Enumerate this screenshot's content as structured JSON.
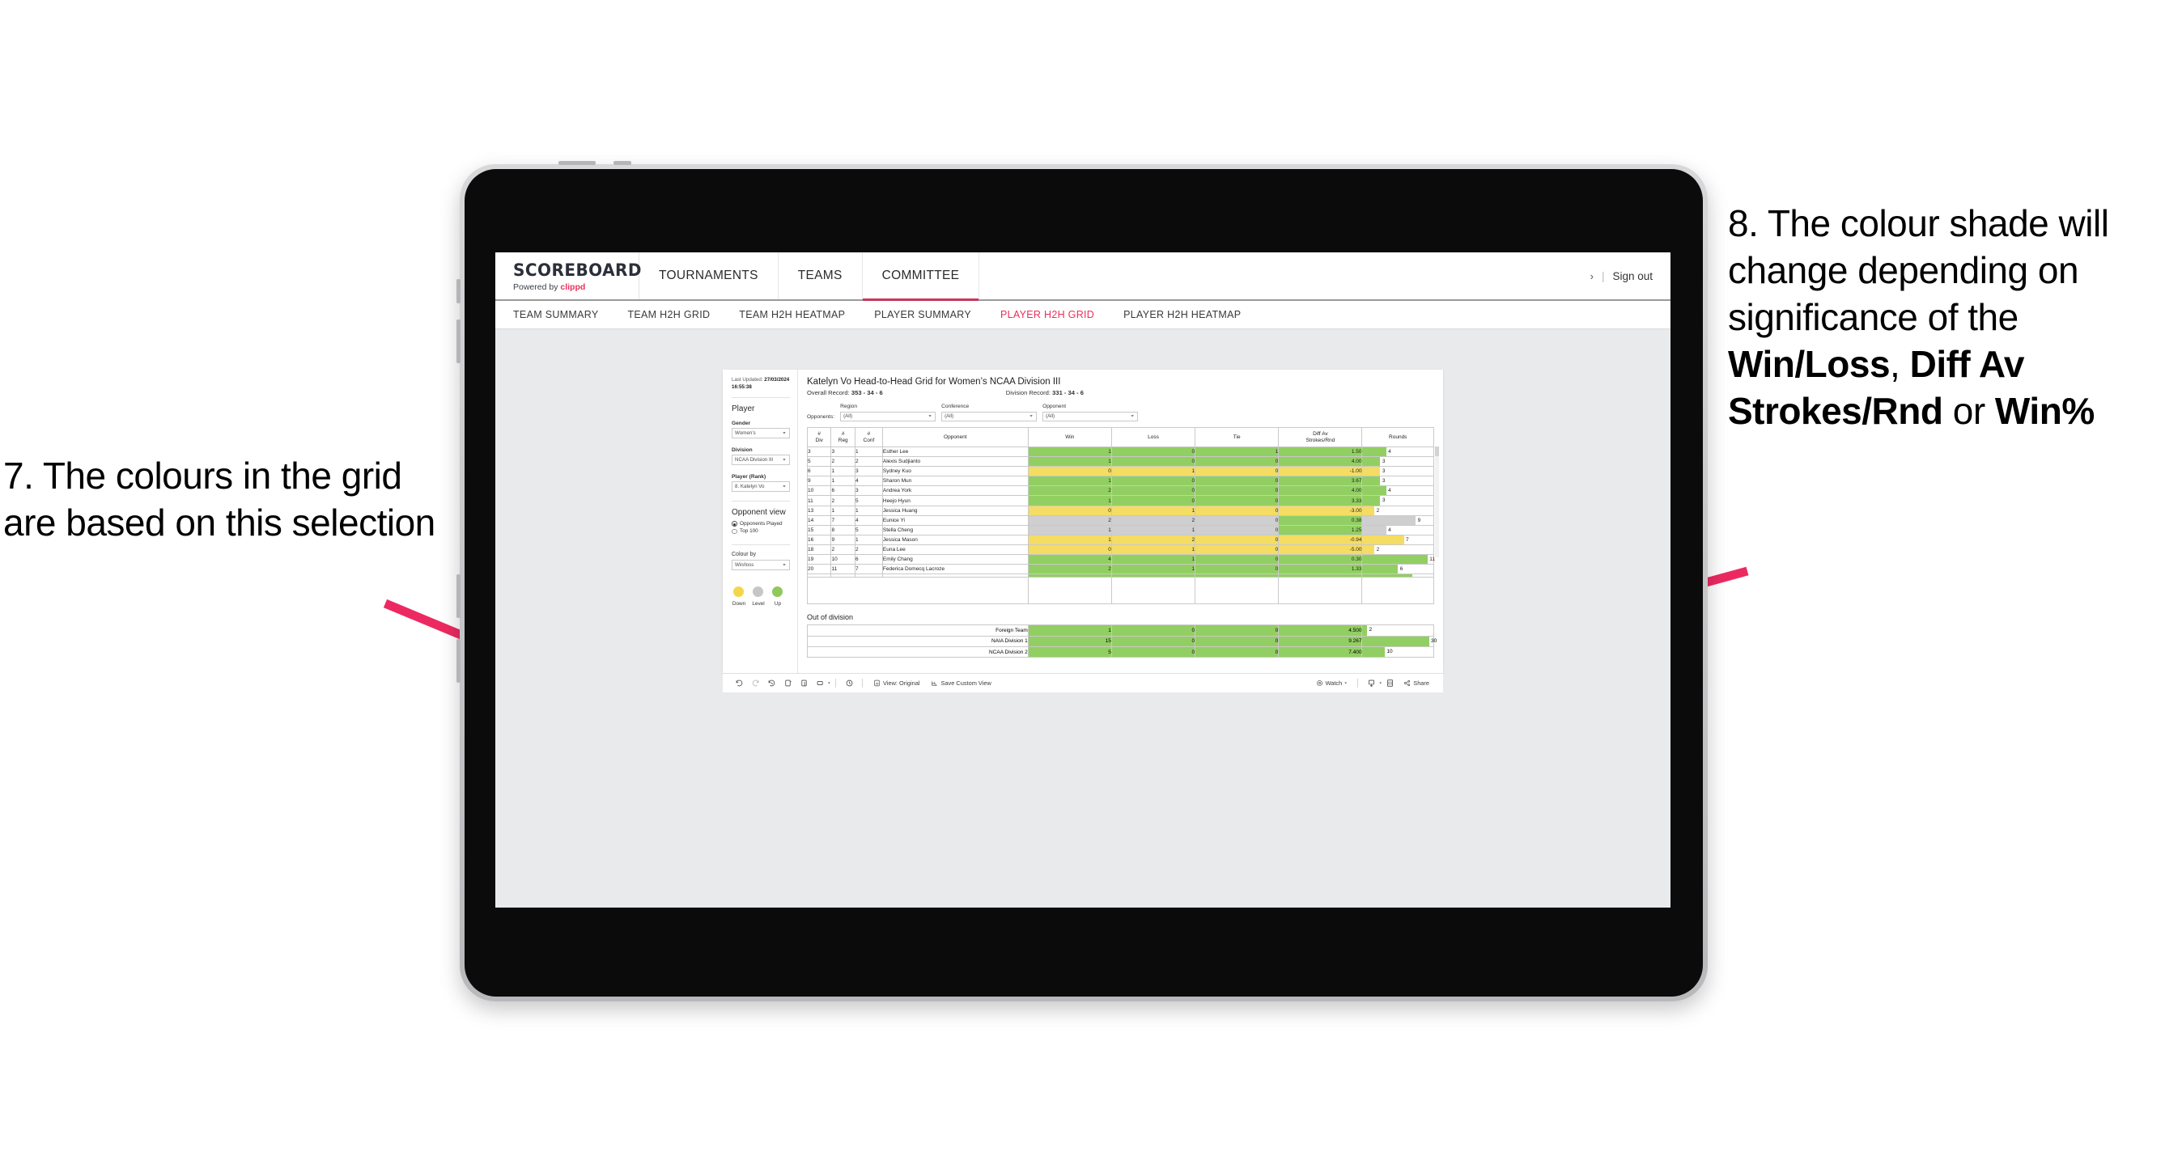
{
  "annotations": {
    "left": "7. The colours in the grid are based on this selection",
    "right_plain_1": "8. The colour shade will change depending on significance of the ",
    "right_bold_1": "Win/Loss",
    "right_plain_2": ", ",
    "right_bold_2": "Diff Av Strokes/Rnd",
    "right_plain_3": " or ",
    "right_bold_3": "Win%",
    "arrow_color": "#ec2a61"
  },
  "app": {
    "logo_main": "SCOREBOARD",
    "logo_sub_prefix": "Powered by ",
    "logo_brand": "clippd",
    "top_nav": [
      {
        "label": "TOURNAMENTS",
        "active": false
      },
      {
        "label": "TEAMS",
        "active": false
      },
      {
        "label": "COMMITTEE",
        "active": true
      }
    ],
    "chevron": "›",
    "separator": "|",
    "sign_out": "Sign out",
    "sub_nav": [
      {
        "label": "TEAM SUMMARY",
        "active": false
      },
      {
        "label": "TEAM H2H GRID",
        "active": false
      },
      {
        "label": "TEAM H2H HEATMAP",
        "active": false
      },
      {
        "label": "PLAYER SUMMARY",
        "active": false
      },
      {
        "label": "PLAYER H2H GRID",
        "active": true
      },
      {
        "label": "PLAYER H2H HEATMAP",
        "active": false
      }
    ]
  },
  "filters": {
    "last_updated_label": "Last Updated: ",
    "last_updated_value": "27/03/2024 16:55:38",
    "section_player": "Player",
    "gender_label": "Gender",
    "gender_value": "Women’s",
    "division_label": "Division",
    "division_value": "NCAA Division III",
    "player_label": "Player (Rank)",
    "player_value": "8. Katelyn Vo",
    "opponent_view_label": "Opponent view",
    "opponent_view_options": [
      {
        "label": "Opponents Played",
        "selected": true
      },
      {
        "label": "Top 100",
        "selected": false
      }
    ],
    "colour_by_label": "Colour by",
    "colour_by_value": "Win/loss",
    "legend": [
      {
        "label": "Down",
        "color": "#f3d64b"
      },
      {
        "label": "Level",
        "color": "#c4c6c8"
      },
      {
        "label": "Up",
        "color": "#8fc95a"
      }
    ]
  },
  "viz": {
    "title": "Katelyn Vo Head-to-Head Grid for Women’s NCAA Division III",
    "overall_record_label": "Overall Record: ",
    "overall_record_value": "353 -  34 - 6",
    "division_record_label": "Division Record: ",
    "division_record_value": "331 -  34 - 6",
    "opponents_label": "Opponents:",
    "opponent_filters": [
      {
        "label": "Region",
        "value": "(All)"
      },
      {
        "label": "Conference",
        "value": "(All)"
      },
      {
        "label": "Opponent",
        "value": "(All)"
      }
    ],
    "columns": [
      "#\nDiv",
      "#\nReg",
      "#\nConf",
      "Opponent",
      "Win",
      "Loss",
      "Tie",
      "Diff Av\nStrokes/Rnd",
      "Rounds"
    ],
    "col_div": "# Div",
    "col_reg": "# Reg",
    "col_conf": "# Conf",
    "col_opponent": "Opponent",
    "col_win": "Win",
    "col_loss": "Loss",
    "col_tie": "Tie",
    "col_diff": "Diff Av Strokes/Rnd",
    "col_rounds": "Rounds",
    "rows": [
      {
        "div": "3",
        "reg": "3",
        "conf": "1",
        "opponent": "Esther Lee",
        "win": "1",
        "loss": "0",
        "tie": "1",
        "diff": "1.50",
        "rounds": "4",
        "shade": "g"
      },
      {
        "div": "5",
        "reg": "2",
        "conf": "2",
        "opponent": "Alexis Sudjianto",
        "win": "1",
        "loss": "0",
        "tie": "0",
        "diff": "4.00",
        "rounds": "3",
        "shade": "g"
      },
      {
        "div": "6",
        "reg": "1",
        "conf": "3",
        "opponent": "Sydney Kuo",
        "win": "0",
        "loss": "1",
        "tie": "0",
        "diff": "-1.00",
        "rounds": "3",
        "shade": "y"
      },
      {
        "div": "9",
        "reg": "1",
        "conf": "4",
        "opponent": "Sharon Mun",
        "win": "1",
        "loss": "0",
        "tie": "0",
        "diff": "3.67",
        "rounds": "3",
        "shade": "g"
      },
      {
        "div": "10",
        "reg": "6",
        "conf": "3",
        "opponent": "Andrea York",
        "win": "2",
        "loss": "0",
        "tie": "0",
        "diff": "4.00",
        "rounds": "4",
        "shade": "g"
      },
      {
        "div": "11",
        "reg": "2",
        "conf": "5",
        "opponent": "Heejo Hyun",
        "win": "1",
        "loss": "0",
        "tie": "0",
        "diff": "3.33",
        "rounds": "3",
        "shade": "g"
      },
      {
        "div": "13",
        "reg": "1",
        "conf": "1",
        "opponent": "Jessica Huang",
        "win": "0",
        "loss": "1",
        "tie": "0",
        "diff": "-3.00",
        "rounds": "2",
        "shade": "y"
      },
      {
        "div": "14",
        "reg": "7",
        "conf": "4",
        "opponent": "Eunice Yi",
        "win": "2",
        "loss": "2",
        "tie": "0",
        "diff": "0.38",
        "rounds": "9",
        "shade": "gr",
        "diff_shade": "g"
      },
      {
        "div": "15",
        "reg": "8",
        "conf": "5",
        "opponent": "Stella Cheng",
        "win": "1",
        "loss": "1",
        "tie": "0",
        "diff": "1.25",
        "rounds": "4",
        "shade": "gr",
        "diff_shade": "g"
      },
      {
        "div": "16",
        "reg": "9",
        "conf": "1",
        "opponent": "Jessica Mason",
        "win": "1",
        "loss": "2",
        "tie": "0",
        "diff": "-0.94",
        "rounds": "7",
        "shade": "y"
      },
      {
        "div": "18",
        "reg": "2",
        "conf": "2",
        "opponent": "Euna Lee",
        "win": "0",
        "loss": "1",
        "tie": "0",
        "diff": "-5.00",
        "rounds": "2",
        "shade": "y"
      },
      {
        "div": "19",
        "reg": "10",
        "conf": "6",
        "opponent": "Emily Chang",
        "win": "4",
        "loss": "1",
        "tie": "0",
        "diff": "0.30",
        "rounds": "11",
        "shade": "g"
      },
      {
        "div": "20",
        "reg": "11",
        "conf": "7",
        "opponent": "Federica Domecq Lacroze",
        "win": "2",
        "loss": "1",
        "tie": "0",
        "diff": "1.33",
        "rounds": "6",
        "shade": "g"
      }
    ],
    "out_of_division_title": "Out of division",
    "out_of_division_rows": [
      {
        "name": "Foreign Team",
        "win": "1",
        "loss": "0",
        "tie": "0",
        "diff": "4.500",
        "rounds": "2",
        "shade": "g"
      },
      {
        "name": "NAIA Division 1",
        "win": "15",
        "loss": "0",
        "tie": "0",
        "diff": "9.267",
        "rounds": "30",
        "shade": "g"
      },
      {
        "name": "NCAA Division 2",
        "win": "5",
        "loss": "0",
        "tie": "0",
        "diff": "7.400",
        "rounds": "10",
        "shade": "g"
      }
    ]
  },
  "toolbar": {
    "view_original": "View: Original",
    "save_custom_view": "Save Custom View",
    "watch": "Watch",
    "share": "Share",
    "caret": "▾"
  }
}
